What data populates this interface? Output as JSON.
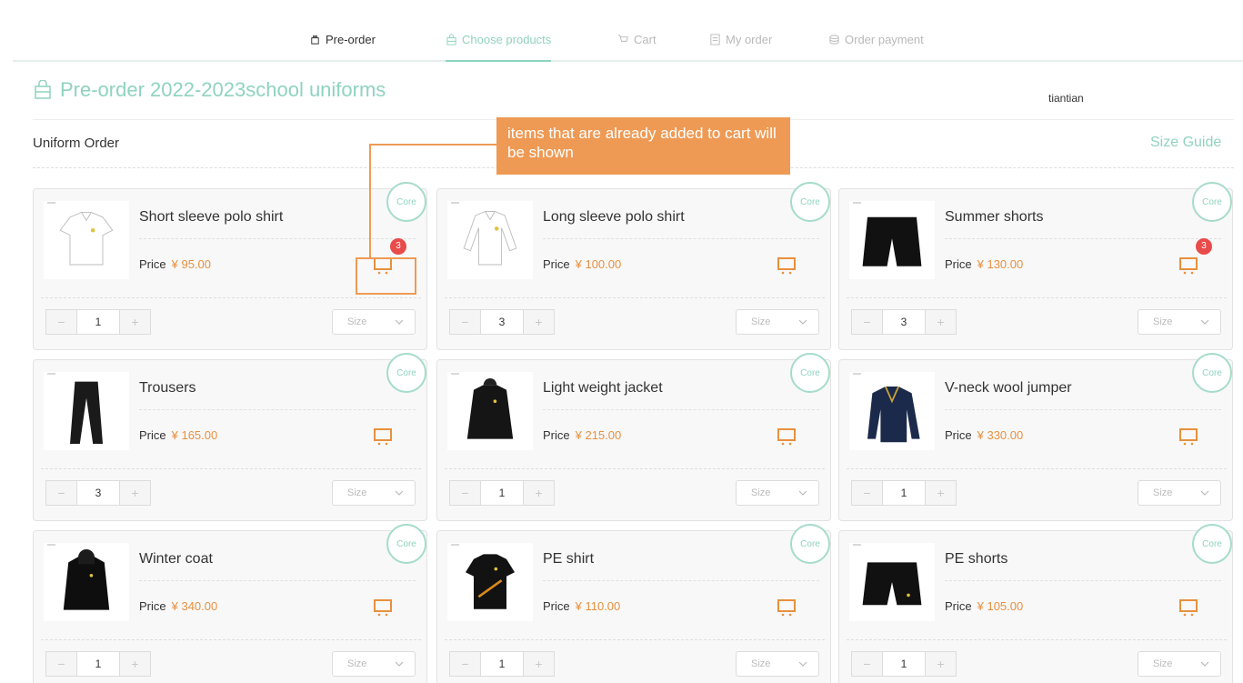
{
  "steps": [
    {
      "label": "Pre-order",
      "icon": "package-open-icon",
      "state": "done"
    },
    {
      "label": "Choose products",
      "icon": "bag-icon",
      "state": "active"
    },
    {
      "label": "Cart",
      "icon": "cart-icon",
      "state": "pending"
    },
    {
      "label": "My order",
      "icon": "list-icon",
      "state": "pending"
    },
    {
      "label": "Order payment",
      "icon": "coins-icon",
      "state": "pending"
    }
  ],
  "header": {
    "title": "Pre-order 2022-2023school uniforms",
    "title_icon": "bag-icon",
    "user": "tiantian"
  },
  "section": {
    "title": "Uniform Order",
    "size_guide": "Size Guide"
  },
  "annotation": {
    "text": "items that are already added to cart will be shown"
  },
  "products": [
    {
      "name": "Short sleeve polo shirt",
      "price_label": "Price",
      "price": "¥ 95.00",
      "tag": "Core",
      "qty": "1",
      "size_placeholder": "Size",
      "cart_count": "3",
      "image": "white-polo-short"
    },
    {
      "name": "Long sleeve polo shirt",
      "price_label": "Price",
      "price": "¥ 100.00",
      "tag": "Core",
      "qty": "3",
      "size_placeholder": "Size",
      "cart_count": null,
      "image": "white-polo-long"
    },
    {
      "name": "Summer shorts",
      "price_label": "Price",
      "price": "¥ 130.00",
      "tag": "Core",
      "qty": "3",
      "size_placeholder": "Size",
      "cart_count": "3",
      "image": "black-shorts"
    },
    {
      "name": "Trousers",
      "price_label": "Price",
      "price": "¥ 165.00",
      "tag": "Core",
      "qty": "3",
      "size_placeholder": "Size",
      "cart_count": null,
      "image": "black-trousers"
    },
    {
      "name": "Light weight jacket",
      "price_label": "Price",
      "price": "¥ 215.00",
      "tag": "Core",
      "qty": "1",
      "size_placeholder": "Size",
      "cart_count": null,
      "image": "black-jacket"
    },
    {
      "name": "V-neck wool jumper",
      "price_label": "Price",
      "price": "¥ 330.00",
      "tag": "Core",
      "qty": "1",
      "size_placeholder": "Size",
      "cart_count": null,
      "image": "navy-jumper"
    },
    {
      "name": "Winter coat",
      "price_label": "Price",
      "price": "¥ 340.00",
      "tag": "Core",
      "qty": "1",
      "size_placeholder": "Size",
      "cart_count": null,
      "image": "black-coat"
    },
    {
      "name": "PE shirt",
      "price_label": "Price",
      "price": "¥ 110.00",
      "tag": "Core",
      "qty": "1",
      "size_placeholder": "Size",
      "cart_count": null,
      "image": "black-pe-shirt"
    },
    {
      "name": "PE shorts",
      "price_label": "Price",
      "price": "¥ 105.00",
      "tag": "Core",
      "qty": "1",
      "size_placeholder": "Size",
      "cart_count": null,
      "image": "black-pe-shorts"
    }
  ],
  "colors": {
    "accent": "#8fd3bf",
    "price": "#e8903f",
    "badge": "#e94b4b",
    "callout": "#ee9a55"
  }
}
